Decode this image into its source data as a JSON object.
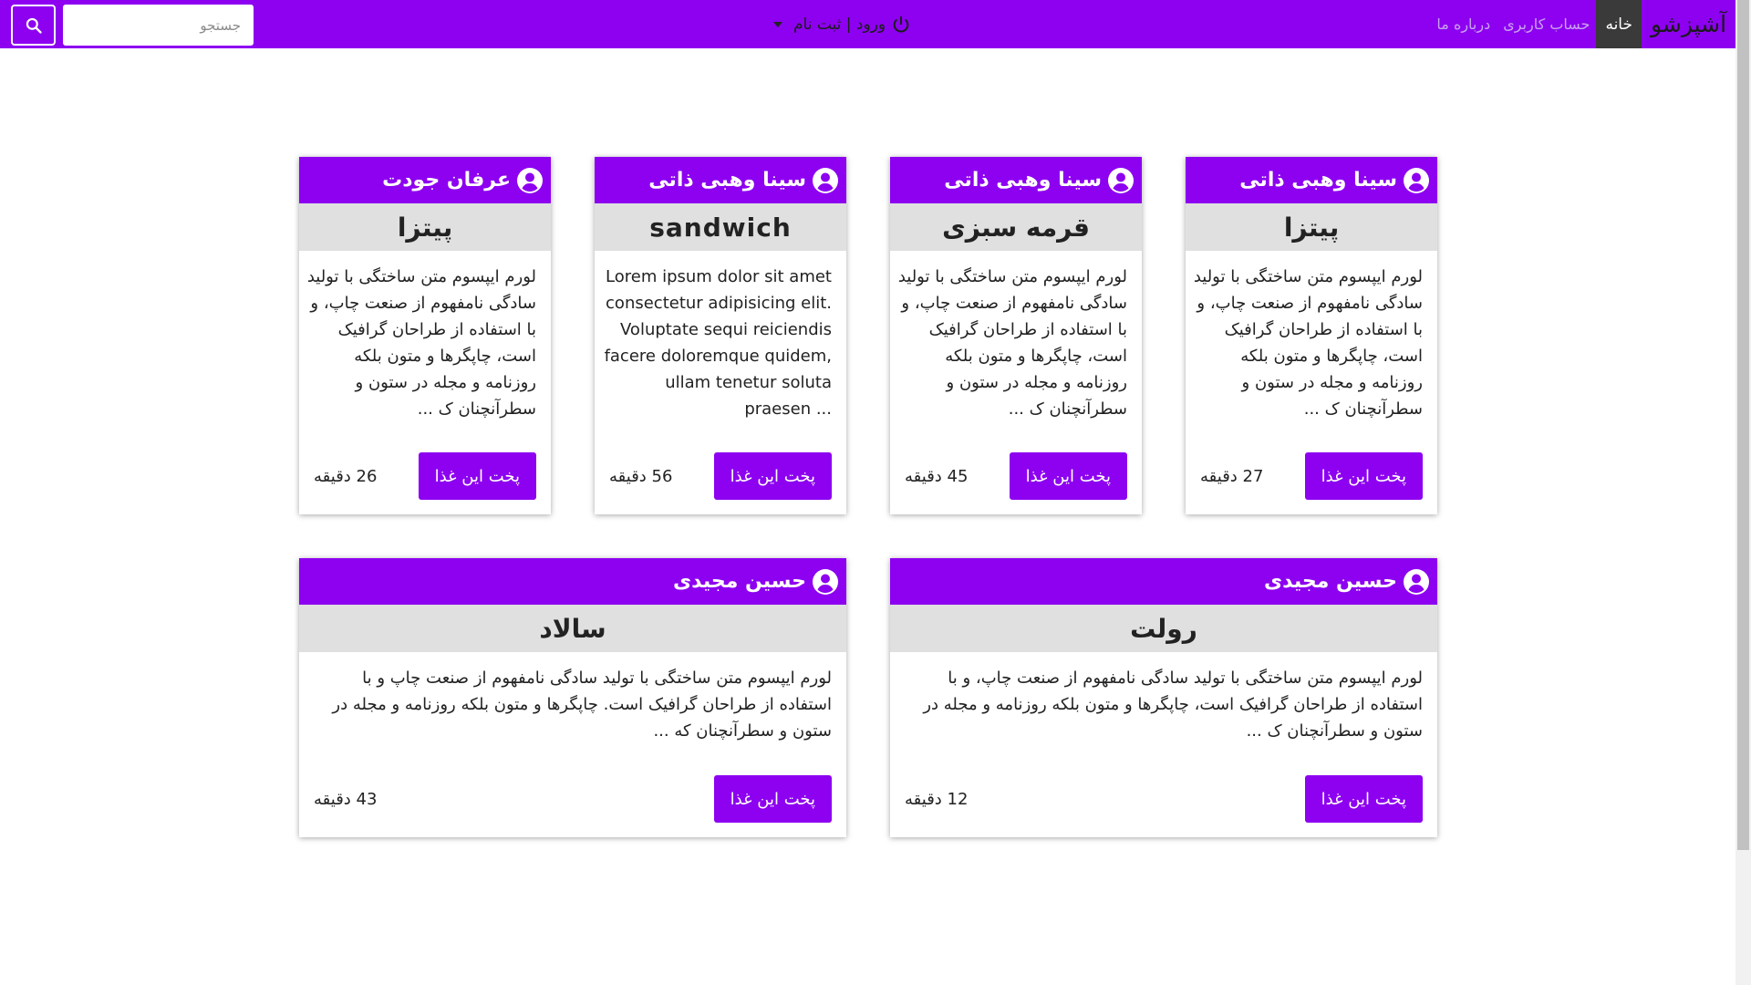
{
  "navbar": {
    "brand": "آشپزشو",
    "links": [
      "خانه",
      "حساب کاربری",
      "درباره ما"
    ],
    "login_label": "ورود | ثبت نام",
    "search_placeholder": "جستجو",
    "accent_color": "#8d00f0"
  },
  "icons": {
    "search": "search-icon",
    "power": "power-icon",
    "user": "user-circle-icon",
    "caret": "caret-down-icon"
  },
  "cards": [
    {
      "author": "سینا وهبی ذاتی",
      "title": "پیتزا",
      "description": "لورم ایپسوم متن ساختگی با تولید سادگی نامفهوم از صنعت چاپ، و با استفاده از طراحان گرافیک است، چاپگرها و متون بلکه روزنامه و مجله در ستون و سطرآنچنان ک ...",
      "button": "پخت این غذا",
      "duration": "27 دقیقه"
    },
    {
      "author": "سینا وهبی ذاتی",
      "title": "قرمه سبزی",
      "description": "لورم ایپسوم متن ساختگی با تولید سادگی نامفهوم از صنعت چاپ، و با استفاده از طراحان گرافیک است، چاپگرها و متون بلکه روزنامه و مجله در ستون و سطرآنچنان ک ...",
      "button": "پخت این غذا",
      "duration": "45 دقیقه"
    },
    {
      "author": "سینا وهبی ذاتی",
      "title": "sandwich",
      "description": "Lorem ipsum dolor sit amet consectetur adipisicing elit. Voluptate sequi reiciendis facere doloremque quidem, ullam tenetur soluta praesen ...",
      "button": "پخت این غذا",
      "duration": "56 دقیقه"
    },
    {
      "author": "عرفان جودت",
      "title": "پیتزا",
      "description": "لورم ایپسوم متن ساختگی با تولید سادگی نامفهوم از صنعت چاپ، و با استفاده از طراحان گرافیک است، چاپگرها و متون بلکه روزنامه و مجله در ستون و سطرآنچنان ک ...",
      "button": "پخت این غذا",
      "duration": "26 دقیقه"
    },
    {
      "author": "حسین مجیدی",
      "title": "رولت",
      "description": "لورم ایپسوم متن ساختگی با تولید سادگی نامفهوم از صنعت چاپ، و با استفاده از طراحان گرافیک است، چاپگرها و متون بلکه روزنامه و مجله در ستون و سطرآنچنان ک ...",
      "button": "پخت این غذا",
      "duration": "12 دقیقه"
    },
    {
      "author": "حسین مجیدی",
      "title": "سالاد",
      "description": "لورم ایپسوم متن ساختگی با تولید سادگی نامفهوم از صنعت چاپ و با استفاده از طراحان گرافیک است. چاپگرها و متون بلکه روزنامه و مجله در ستون و سطرآنچنان که ...",
      "button": "پخت این غذا",
      "duration": "43 دقیقه"
    }
  ]
}
